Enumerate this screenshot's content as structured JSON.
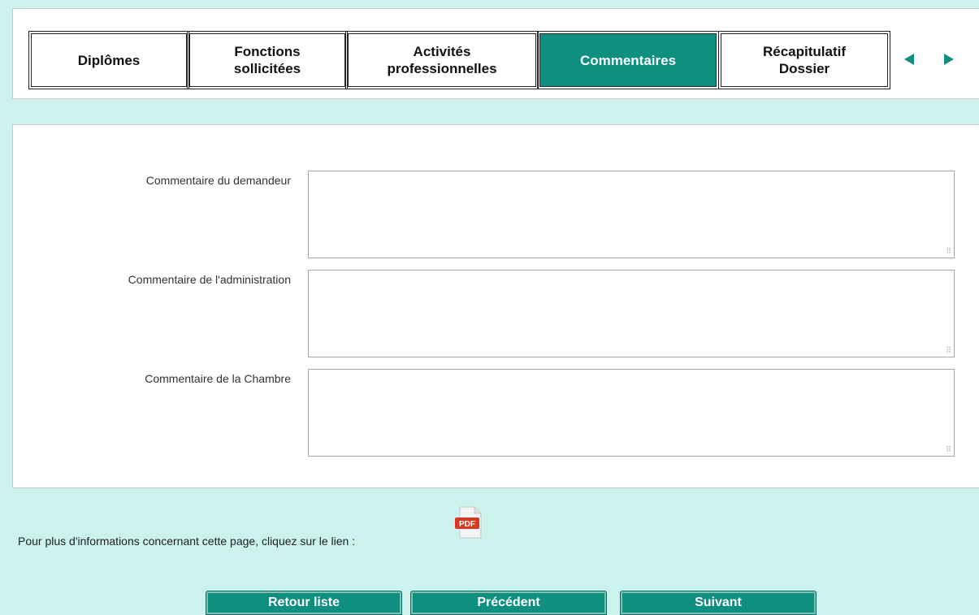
{
  "tabs": [
    {
      "label": "Diplômes",
      "active": false
    },
    {
      "label": "Fonctions\nsollicitées",
      "active": false
    },
    {
      "label": "Activités\nprofessionnelles",
      "active": false
    },
    {
      "label": "Commentaires",
      "active": true
    },
    {
      "label": "Récapitulatif\nDossier",
      "active": false
    }
  ],
  "nav_icons": {
    "prev": "triangle-left-icon",
    "next": "triangle-right-icon"
  },
  "fields": {
    "demandeur": {
      "label": "Commentaire du demandeur",
      "value": ""
    },
    "administration": {
      "label": "Commentaire de l'administration",
      "value": ""
    },
    "chambre": {
      "label": "Commentaire de la Chambre",
      "value": ""
    }
  },
  "info": {
    "text": "Pour plus d'informations concernant cette page, cliquez sur le lien :",
    "icon_label": "PDF",
    "icon": "pdf-icon"
  },
  "buttons": {
    "back": "Retour liste",
    "prev": "Précédent",
    "next": "Suivant"
  },
  "colors": {
    "accent": "#0e8f80",
    "background": "#cbf2ec"
  }
}
